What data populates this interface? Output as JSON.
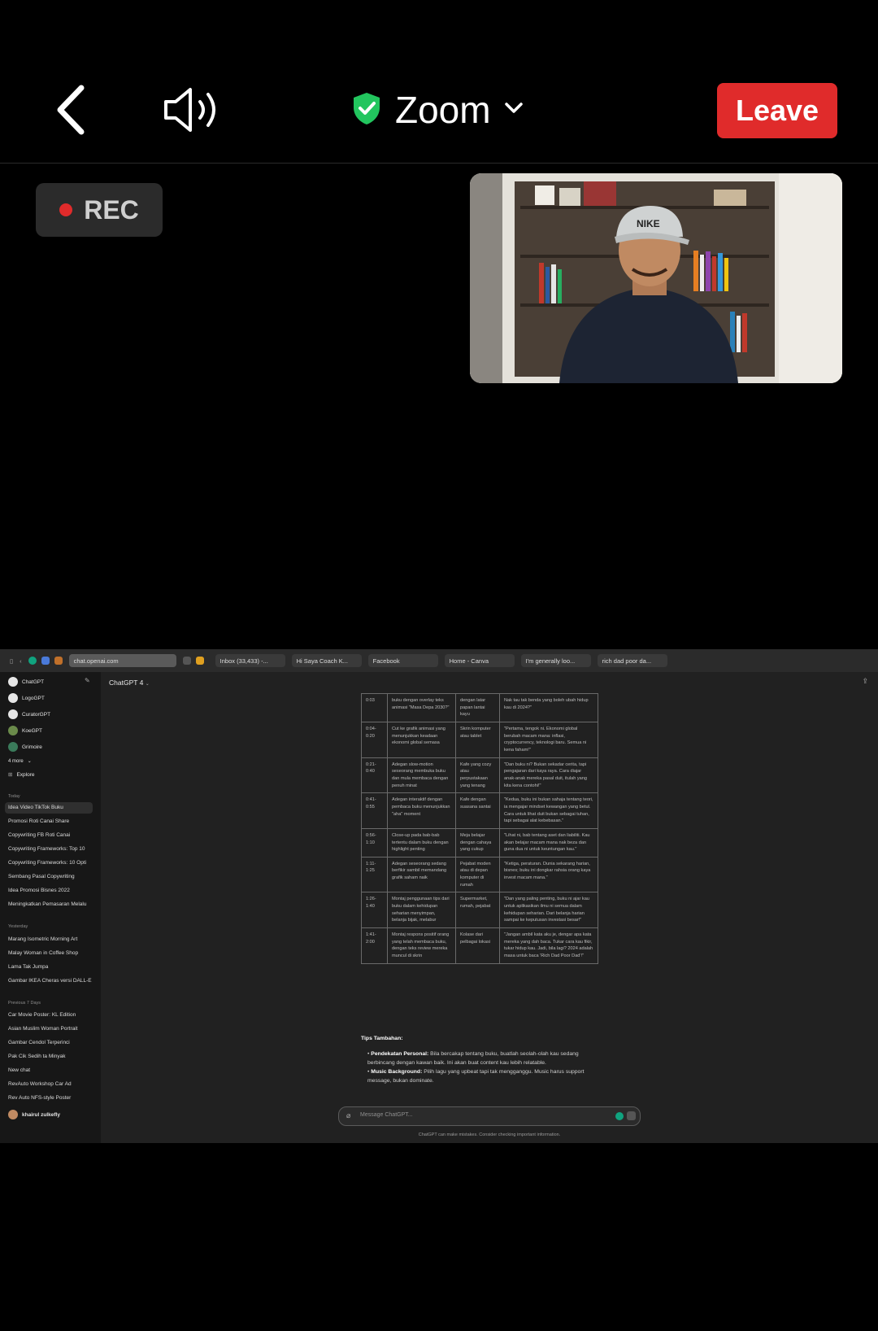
{
  "zoom_bar": {
    "title": "Zoom",
    "leave_label": "Leave",
    "rec_label": "REC",
    "leave_color": "#e02b2b",
    "shield_color": "#22c55e"
  },
  "browser": {
    "tabs": [
      {
        "label": "chat.openai.com"
      },
      {
        "label": "Inbox (33,433) -..."
      },
      {
        "label": "Hi Saya Coach K..."
      },
      {
        "label": "Facebook"
      },
      {
        "label": "Home - Canva"
      },
      {
        "label": "I'm generally loo..."
      },
      {
        "label": "rich dad poor da..."
      }
    ]
  },
  "sidebar": {
    "gpts": [
      {
        "label": "ChatGPT"
      },
      {
        "label": "LogoGPT"
      },
      {
        "label": "CuratorGPT"
      },
      {
        "label": "KoeGPT"
      },
      {
        "label": "Grimoire"
      }
    ],
    "more_label": "4 more",
    "explore_label": "Explore",
    "today_label": "Today",
    "today": [
      {
        "label": "Idea Video TikTok Buku"
      },
      {
        "label": "Promosi Roti Canai Share"
      },
      {
        "label": "Copywriting FB Roti Canai"
      },
      {
        "label": "Copywriting Frameworks: Top 10"
      },
      {
        "label": "Copywriting Frameworks: 10 Opti"
      },
      {
        "label": "Sembang Pasal Copywriting"
      },
      {
        "label": "Idea Promosi Bisnes 2022"
      },
      {
        "label": "Meningkatkan Pemasaran Melalu"
      }
    ],
    "yesterday_label": "Yesterday",
    "yesterday": [
      {
        "label": "Marang Isometric Morning Art"
      },
      {
        "label": "Malay Woman in Coffee Shop"
      },
      {
        "label": "Lama Tak Jumpa"
      },
      {
        "label": "Gambar IKEA Cheras versi DALL-E"
      }
    ],
    "prev_label": "Previous 7 Days",
    "previous": [
      {
        "label": "Car Movie Poster: KL Edition"
      },
      {
        "label": "Asian Muslim Woman Portrait"
      },
      {
        "label": "Gambar Cendol Terperinci"
      },
      {
        "label": "Pak Cik Sedih ta Minyak"
      },
      {
        "label": "New chat"
      },
      {
        "label": "RevAuto Workshop Car Ad"
      },
      {
        "label": "Rev Auto NFS-style Poster"
      }
    ],
    "user_name": "khairul zulkefly"
  },
  "chat": {
    "model_label": "ChatGPT 4",
    "rows": [
      {
        "time": "0:03",
        "visual": "buku dengan overlay teks animasi \"Masa Depa 2030?\"",
        "setting": "dengan latar papan lantai kayu",
        "audio": "Nak tau tak benda yang boleh ubah hidup kau di 2024?\""
      },
      {
        "time": "0:04-0:20",
        "visual": "Cut ke grafik animasi yang menunjukkan keadaan ekonomi global semasa",
        "setting": "Skrin komputer atau tablet",
        "audio": "\"Pertama, tengok ni. Ekonomi global berubah macam mana: inflasi, cryptocurrency, teknologi baru. Semua ni kena faham!\""
      },
      {
        "time": "0:21-0:40",
        "visual": "Adegan slow-motion seseorang membuka buku dan mula membaca dengan penuh minat",
        "setting": "Kafe yang cozy atau perpustakaan yang tenang",
        "audio": "\"Dan buku ni? Bukan sekadar cerita, tapi pengajaran dari kaya raya. Cara diajar anak-anak mereka pasal duit, itulah yang kita kena contohi!\""
      },
      {
        "time": "0:41-0:55",
        "visual": "Adegan interaktif dengan pembaca buku menunjukkan \"aha\" moment",
        "setting": "Kafe dengan suasana santai",
        "audio": "\"Kedua, buku ini bukan sahaja tentang teori, ia mengajar mindset kewangan yang betul. Cara untuk lihat duit bukan sebagai tuhan, tapi sebagai alat kebebasan.\""
      },
      {
        "time": "0:56-1:10",
        "visual": "Close-up pada bab-bab tertentu dalam buku dengan highlight penting",
        "setting": "Meja belajar dengan cahaya yang cukup",
        "audio": "\"Lihat ni, bab tentang aset dan liabiliti. Kau akan belajar macam mana nak beza dan guna dua ni untuk keuntungan kau.\""
      },
      {
        "time": "1:11-1:25",
        "visual": "Adegan seseorang sedang berfikir sambil memandang grafik saham naik",
        "setting": "Pejabat moden atau di depan komputer di rumah",
        "audio": "\"Ketiga, peraturan. Dunia sekarang harian, bisnes; buku ini dongkar rahsia orang kaya invest macam mana.\""
      },
      {
        "time": "1:26-1:40",
        "visual": "Montaj penggunaan tips dari buku dalam kehidupan seharian menyimpan, belanja bijak, melabur",
        "setting": "Supermarket, rumah, pejabat",
        "audio": "\"Dan yang paling penting, buku ni ajar kau untuk aplikasikan ilmu ni semua dalam kehidupan seharian. Dari belanja harian sampai ke keputusan investasi besar!\""
      },
      {
        "time": "1:41-2:00",
        "visual": "Montaj respons positif orang yang telah membaca buku, dengan teks review mereka muncul di skrin",
        "setting": "Kolase dari pelbagai lokasi",
        "audio": "\"Jangan ambil kata aku je, dengar apa kata mereka yang dah baca. Tukar cara kau fikir, tukar hidup kau. Jadi, bila lagi? 2024 adalah masa untuk baca 'Rich Dad Poor Dad'!\""
      }
    ],
    "tips_title": "Tips Tambahan:",
    "tip1_bold": "Pendekatan Personal:",
    "tip1_text": " Bila bercakap tentang buku, buatlah seolah-olah kau sedang berbincang dengan kawan baik. Ini akan buat content kau lebih relatable.",
    "tip2_bold": "Music Background:",
    "tip2_text": " Pilih lagu yang upbeat tapi tak mengganggu. Music harus support message, bukan dominate.",
    "input_placeholder": "Message ChatGPT...",
    "disclaimer": "ChatGPT can make mistakes. Consider checking important information."
  }
}
